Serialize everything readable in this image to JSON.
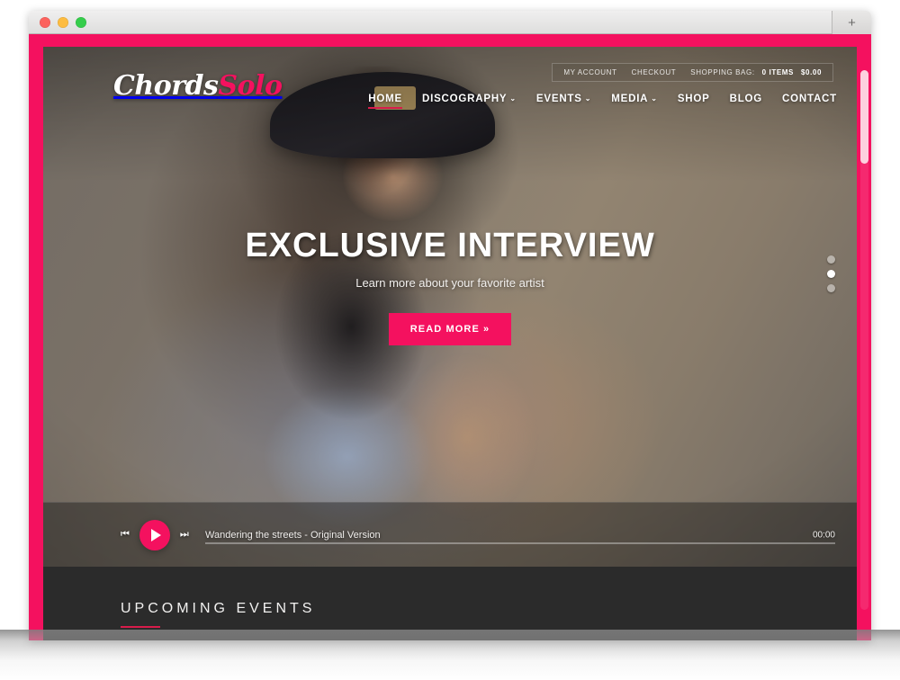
{
  "window": {
    "traffic_lights": [
      "close",
      "minimize",
      "maximize"
    ],
    "new_tab_label": "+"
  },
  "utility_bar": {
    "my_account": "MY ACCOUNT",
    "checkout": "CHECKOUT",
    "shopping_bag_label": "SHOPPING BAG:",
    "items": "0 ITEMS",
    "total": "$0.00"
  },
  "logo": {
    "part1": "Chords",
    "part2": "Solo"
  },
  "nav": {
    "items": [
      {
        "label": "HOME",
        "caret": "",
        "active": true
      },
      {
        "label": "DISCOGRAPHY",
        "caret": "⌄",
        "active": false
      },
      {
        "label": "EVENTS",
        "caret": "⌄",
        "active": false
      },
      {
        "label": "MEDIA",
        "caret": "⌄",
        "active": false
      },
      {
        "label": "SHOP",
        "caret": "",
        "active": false
      },
      {
        "label": "BLOG",
        "caret": "",
        "active": false
      },
      {
        "label": "CONTACT",
        "caret": "",
        "active": false
      }
    ]
  },
  "hero": {
    "title": "EXCLUSIVE INTERVIEW",
    "subtitle": "Learn more about your favorite artist",
    "cta_label": "READ MORE »",
    "slides": 3,
    "active_slide": 2
  },
  "player": {
    "prev_icon": "⏮",
    "next_icon": "⏭",
    "play_icon": "play-triangle",
    "track_title": "Wandering the streets - Original Version",
    "time": "00:00",
    "progress_percent": 0
  },
  "upcoming": {
    "title": "UPCOMING EVENTS"
  },
  "colors": {
    "accent_pink": "#f4115f",
    "underline_crimson": "#d81c4b",
    "dark_section": "#2b2b2b"
  }
}
